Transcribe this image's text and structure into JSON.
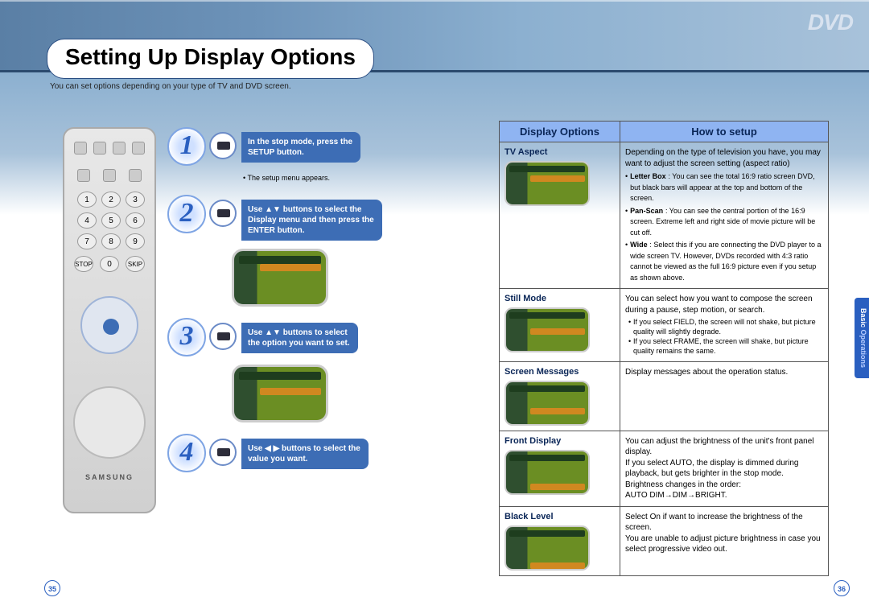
{
  "header": {
    "title": "Setting Up Display Options",
    "logo_text": "DVD",
    "intro": "You can set options depending on your type of TV and DVD screen."
  },
  "remote": {
    "brand": "SAMSUNG"
  },
  "steps": [
    {
      "num": "1",
      "text_line1": "In the stop mode, press the",
      "text_line2": "SETUP button.",
      "note": "• The setup menu appears."
    },
    {
      "num": "2",
      "text_line1": "Use ▲▼ buttons to select the",
      "text_line2": "Display menu and then press the",
      "text_line3": "ENTER button."
    },
    {
      "num": "3",
      "text_line1": "Use ▲▼ buttons to select",
      "text_line2": "the option you want to set."
    },
    {
      "num": "4",
      "text_line1": "Use ◀ ▶ buttons to select the",
      "text_line2": "value you want."
    }
  ],
  "table": {
    "header_left": "Display Options",
    "header_right": "How to setup",
    "rows": [
      {
        "label": "TV Aspect",
        "intro": "Depending on the type of television you have, you may want to adjust the screen setting (aspect ratio)",
        "defs": [
          {
            "term": "Letter Box",
            "def": ": You can see the total 16:9 ratio screen DVD, but black bars will appear at the top and bottom of the screen."
          },
          {
            "term": "Pan-Scan",
            "def": ": You can see the central portion of the 16:9 screen. Extreme left and right side of movie picture will be cut off."
          },
          {
            "term": "Wide",
            "def": ": Select this if you are connecting the DVD player to a wide screen TV. However, DVDs recorded with 4:3 ratio cannot be viewed as the full 16:9 picture even if you setup as shown above."
          }
        ]
      },
      {
        "label": "Still Mode",
        "intro": "You can select how you want to compose the screen during a pause, step motion, or search.",
        "bullets": [
          "If you select FIELD, the screen will not shake, but picture quality will slightly degrade.",
          "If you select FRAME, the screen will shake, but picture quality remains the same."
        ]
      },
      {
        "label": "Screen Messages",
        "intro": "Display messages about the operation status."
      },
      {
        "label": "Front Display",
        "intro": "You can adjust the brightness of the unit's front panel display.\nIf you select AUTO, the display is dimmed during playback, but gets brighter in the stop mode.\nBrightness changes in the order:\nAUTO DIM→DIM→BRIGHT."
      },
      {
        "label": "Black Level",
        "intro": "Select On if want to increase the brightness of the screen.\nYou are unable to adjust picture brightness in case you select progressive video out."
      }
    ]
  },
  "sidebar": {
    "line1": "Basic",
    "line2": "Operations"
  },
  "page_left": "35",
  "page_right": "36"
}
